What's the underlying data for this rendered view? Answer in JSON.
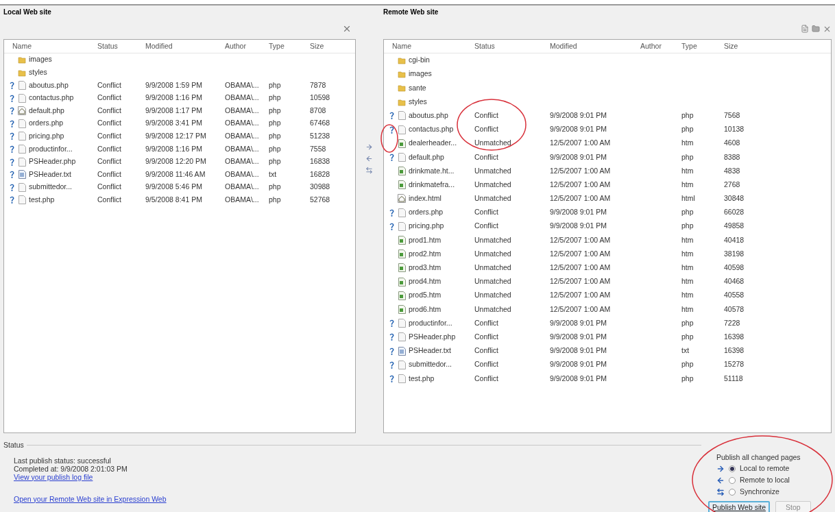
{
  "local": {
    "title": "Local Web site",
    "columns": [
      "Name",
      "Status",
      "Modified",
      "Author",
      "Type",
      "Size"
    ],
    "rows": [
      {
        "kind": "folder",
        "conflict": false,
        "name": "images"
      },
      {
        "kind": "folder",
        "conflict": false,
        "name": "styles"
      },
      {
        "kind": "page",
        "conflict": true,
        "name": "aboutus.php",
        "status": "Conflict",
        "modified": "9/9/2008 1:59 PM",
        "author": "OBAMA\\...",
        "type": "php",
        "size": "7878"
      },
      {
        "kind": "page",
        "conflict": true,
        "name": "contactus.php",
        "status": "Conflict",
        "modified": "9/9/2008 1:16 PM",
        "author": "OBAMA\\...",
        "type": "php",
        "size": "10598"
      },
      {
        "kind": "home",
        "conflict": true,
        "name": "default.php",
        "status": "Conflict",
        "modified": "9/9/2008 1:17 PM",
        "author": "OBAMA\\...",
        "type": "php",
        "size": "8708"
      },
      {
        "kind": "page",
        "conflict": true,
        "name": "orders.php",
        "status": "Conflict",
        "modified": "9/9/2008 3:41 PM",
        "author": "OBAMA\\...",
        "type": "php",
        "size": "67468"
      },
      {
        "kind": "page",
        "conflict": true,
        "name": "pricing.php",
        "status": "Conflict",
        "modified": "9/9/2008 12:17 PM",
        "author": "OBAMA\\...",
        "type": "php",
        "size": "51238"
      },
      {
        "kind": "page",
        "conflict": true,
        "name": "productinfor...",
        "status": "Conflict",
        "modified": "9/9/2008 1:16 PM",
        "author": "OBAMA\\...",
        "type": "php",
        "size": "7558"
      },
      {
        "kind": "page",
        "conflict": true,
        "name": "PSHeader.php",
        "status": "Conflict",
        "modified": "9/9/2008 12:20 PM",
        "author": "OBAMA\\...",
        "type": "php",
        "size": "16838"
      },
      {
        "kind": "textfile",
        "conflict": true,
        "name": "PSHeader.txt",
        "status": "Conflict",
        "modified": "9/9/2008 11:46 AM",
        "author": "OBAMA\\...",
        "type": "txt",
        "size": "16828"
      },
      {
        "kind": "page",
        "conflict": true,
        "name": "submittedor...",
        "status": "Conflict",
        "modified": "9/9/2008 5:46 PM",
        "author": "OBAMA\\...",
        "type": "php",
        "size": "30988"
      },
      {
        "kind": "page",
        "conflict": true,
        "name": "test.php",
        "status": "Conflict",
        "modified": "9/5/2008 8:41 PM",
        "author": "OBAMA\\...",
        "type": "php",
        "size": "52768"
      }
    ]
  },
  "remote": {
    "title": "Remote Web site",
    "columns": [
      "Name",
      "Status",
      "Modified",
      "Author",
      "Type",
      "Size"
    ],
    "rows": [
      {
        "kind": "folder",
        "conflict": false,
        "name": "cgi-bin"
      },
      {
        "kind": "folder",
        "conflict": false,
        "name": "images"
      },
      {
        "kind": "folder",
        "conflict": false,
        "name": "sante"
      },
      {
        "kind": "folder",
        "conflict": false,
        "name": "styles"
      },
      {
        "kind": "page",
        "conflict": true,
        "name": "aboutus.php",
        "status": "Conflict",
        "modified": "9/9/2008 9:01 PM",
        "type": "php",
        "size": "7568"
      },
      {
        "kind": "page",
        "conflict": true,
        "name": "contactus.php",
        "status": "Conflict",
        "modified": "9/9/2008 9:01 PM",
        "type": "php",
        "size": "10138"
      },
      {
        "kind": "webpage",
        "conflict": false,
        "name": "dealerheader...",
        "status": "Unmatched",
        "modified": "12/5/2007 1:00 AM",
        "type": "htm",
        "size": "4608"
      },
      {
        "kind": "page",
        "conflict": true,
        "name": "default.php",
        "status": "Conflict",
        "modified": "9/9/2008 9:01 PM",
        "type": "php",
        "size": "8388"
      },
      {
        "kind": "webpage",
        "conflict": false,
        "name": "drinkmate.ht...",
        "status": "Unmatched",
        "modified": "12/5/2007 1:00 AM",
        "type": "htm",
        "size": "4838"
      },
      {
        "kind": "webpage",
        "conflict": false,
        "name": "drinkmatefra...",
        "status": "Unmatched",
        "modified": "12/5/2007 1:00 AM",
        "type": "htm",
        "size": "2768"
      },
      {
        "kind": "home",
        "conflict": false,
        "name": "index.html",
        "status": "Unmatched",
        "modified": "12/5/2007 1:00 AM",
        "type": "html",
        "size": "30848"
      },
      {
        "kind": "page",
        "conflict": true,
        "name": "orders.php",
        "status": "Conflict",
        "modified": "9/9/2008 9:01 PM",
        "type": "php",
        "size": "66028"
      },
      {
        "kind": "page",
        "conflict": true,
        "name": "pricing.php",
        "status": "Conflict",
        "modified": "9/9/2008 9:01 PM",
        "type": "php",
        "size": "49858"
      },
      {
        "kind": "webpage",
        "conflict": false,
        "name": "prod1.htm",
        "status": "Unmatched",
        "modified": "12/5/2007 1:00 AM",
        "type": "htm",
        "size": "40418"
      },
      {
        "kind": "webpage",
        "conflict": false,
        "name": "prod2.htm",
        "status": "Unmatched",
        "modified": "12/5/2007 1:00 AM",
        "type": "htm",
        "size": "38198"
      },
      {
        "kind": "webpage",
        "conflict": false,
        "name": "prod3.htm",
        "status": "Unmatched",
        "modified": "12/5/2007 1:00 AM",
        "type": "htm",
        "size": "40598"
      },
      {
        "kind": "webpage",
        "conflict": false,
        "name": "prod4.htm",
        "status": "Unmatched",
        "modified": "12/5/2007 1:00 AM",
        "type": "htm",
        "size": "40468"
      },
      {
        "kind": "webpage",
        "conflict": false,
        "name": "prod5.htm",
        "status": "Unmatched",
        "modified": "12/5/2007 1:00 AM",
        "type": "htm",
        "size": "40558"
      },
      {
        "kind": "webpage",
        "conflict": false,
        "name": "prod6.htm",
        "status": "Unmatched",
        "modified": "12/5/2007 1:00 AM",
        "type": "htm",
        "size": "40578"
      },
      {
        "kind": "page",
        "conflict": true,
        "name": "productinfor...",
        "status": "Conflict",
        "modified": "9/9/2008 9:01 PM",
        "type": "php",
        "size": "7228"
      },
      {
        "kind": "page",
        "conflict": true,
        "name": "PSHeader.php",
        "status": "Conflict",
        "modified": "9/9/2008 9:01 PM",
        "type": "php",
        "size": "16398"
      },
      {
        "kind": "textfile",
        "conflict": true,
        "name": "PSHeader.txt",
        "status": "Conflict",
        "modified": "9/9/2008 9:01 PM",
        "type": "txt",
        "size": "16398"
      },
      {
        "kind": "page",
        "conflict": true,
        "name": "submittedor...",
        "status": "Conflict",
        "modified": "9/9/2008 9:01 PM",
        "type": "php",
        "size": "15278"
      },
      {
        "kind": "page",
        "conflict": true,
        "name": "test.php",
        "status": "Conflict",
        "modified": "9/9/2008 9:01 PM",
        "type": "php",
        "size": "51118"
      }
    ]
  },
  "status": {
    "title": "Status",
    "lines": [
      "Last publish status: successful",
      "Completed at: 9/9/2008 2:01:03 PM"
    ],
    "log_link": "View your publish log file",
    "open_link": "Open your Remote Web site in Expression Web"
  },
  "publish": {
    "title": "Publish all changed pages",
    "options": [
      {
        "kind": "local",
        "label": "Local to remote",
        "selected": true
      },
      {
        "kind": "remote",
        "label": "Remote to local",
        "selected": false
      },
      {
        "kind": "sync",
        "label": "Synchronize",
        "selected": false
      }
    ],
    "buttons": [
      {
        "label": "Publish Web site",
        "disabled": false
      },
      {
        "label": "Stop",
        "disabled": true
      }
    ]
  }
}
